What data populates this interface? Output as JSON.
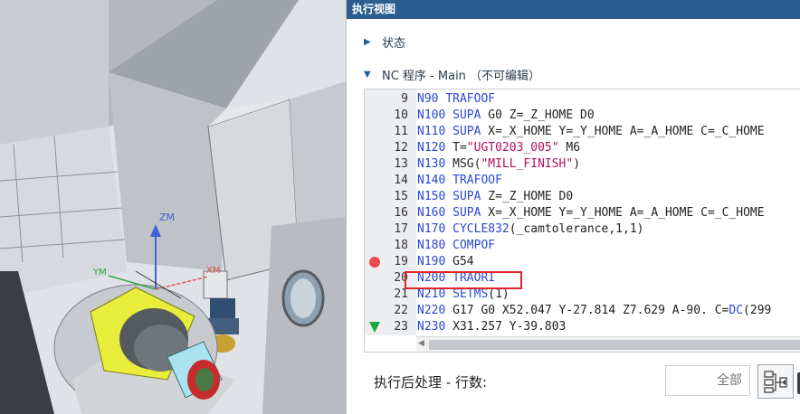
{
  "panel": {
    "title": "执行视图",
    "status_label": "状态",
    "nc_label": "NC 程序 - Main （不可编辑）"
  },
  "viewport": {
    "axis_zm": "ZM",
    "axis_xm": "XM",
    "axis_ym": "YM"
  },
  "code_lines": [
    {
      "num": "9",
      "parts": [
        [
          "N90 ",
          "kw"
        ],
        [
          "TRAFOOF",
          "kw"
        ]
      ]
    },
    {
      "num": "10",
      "parts": [
        [
          "N100 ",
          "kw"
        ],
        [
          "SUPA",
          "kw"
        ],
        [
          " G0 Z=",
          ""
        ],
        [
          "_Z_HOME",
          ""
        ],
        [
          " D0",
          ""
        ]
      ]
    },
    {
      "num": "11",
      "parts": [
        [
          "N110 ",
          "kw"
        ],
        [
          "SUPA",
          "kw"
        ],
        [
          " X=",
          ""
        ],
        [
          "_X_HOME",
          ""
        ],
        [
          " Y=",
          ""
        ],
        [
          "_Y_HOME",
          ""
        ],
        [
          " A=",
          ""
        ],
        [
          "_A_HOME",
          ""
        ],
        [
          " C=",
          ""
        ],
        [
          "_C_HOME",
          ""
        ]
      ]
    },
    {
      "num": "12",
      "parts": [
        [
          "N120 ",
          "kw"
        ],
        [
          "T=",
          ""
        ],
        [
          "\"UGT0203_005\"",
          "str"
        ],
        [
          " M6",
          ""
        ]
      ]
    },
    {
      "num": "13",
      "parts": [
        [
          "N130 ",
          "kw"
        ],
        [
          "MSG(",
          ""
        ],
        [
          "\"MILL_FINISH\"",
          "str"
        ],
        [
          ")",
          ""
        ]
      ]
    },
    {
      "num": "14",
      "parts": [
        [
          "N140 ",
          "kw"
        ],
        [
          "TRAFOOF",
          "kw"
        ]
      ]
    },
    {
      "num": "15",
      "parts": [
        [
          "N150 ",
          "kw"
        ],
        [
          "SUPA",
          "kw"
        ],
        [
          " Z=",
          ""
        ],
        [
          "_Z_HOME",
          ""
        ],
        [
          " D0",
          ""
        ]
      ]
    },
    {
      "num": "16",
      "parts": [
        [
          "N160 ",
          "kw"
        ],
        [
          "SUPA",
          "kw"
        ],
        [
          " X=",
          ""
        ],
        [
          "_X_HOME",
          ""
        ],
        [
          " Y=",
          ""
        ],
        [
          "_Y_HOME",
          ""
        ],
        [
          " A=",
          ""
        ],
        [
          "_A_HOME",
          ""
        ],
        [
          " C=",
          ""
        ],
        [
          "_C_HOME",
          ""
        ]
      ]
    },
    {
      "num": "17",
      "parts": [
        [
          "N170 ",
          "kw"
        ],
        [
          "CYCLE832",
          "kw"
        ],
        [
          "(_camtolerance,1,1)",
          ""
        ]
      ]
    },
    {
      "num": "18",
      "parts": [
        [
          "N180 ",
          "kw"
        ],
        [
          "COMPOF",
          "kw"
        ]
      ]
    },
    {
      "num": "19",
      "parts": [
        [
          "N190 ",
          "kw"
        ],
        [
          "G54",
          ""
        ]
      ],
      "breakpoint": true
    },
    {
      "num": "20",
      "parts": [
        [
          "N200 ",
          "kw"
        ],
        [
          "TRAORI",
          "kw"
        ]
      ]
    },
    {
      "num": "21",
      "parts": [
        [
          "N210 ",
          "kw"
        ],
        [
          "SETMS",
          "kw"
        ],
        [
          "(1)",
          ""
        ]
      ]
    },
    {
      "num": "22",
      "parts": [
        [
          "N220 ",
          "kw"
        ],
        [
          "G17 G0 X52.047 Y-27.814 Z7.629 A-90. C=",
          ""
        ],
        [
          "DC",
          "kw"
        ],
        [
          "(299",
          ""
        ]
      ]
    },
    {
      "num": "23",
      "parts": [
        [
          "N230 ",
          "kw"
        ],
        [
          "X31.257 Y-39.803",
          ""
        ]
      ],
      "current": true
    }
  ],
  "post": {
    "label": "执行后处理 - 行数:",
    "placeholder": "全部"
  },
  "colors": {
    "header_bg": "#2a5f8f",
    "keyword": "#2b46d8",
    "string": "#b0105a",
    "breakpoint": "#ee4a4a",
    "current_line": "#1fa83a",
    "highlight": "#e0252a"
  },
  "icons": {
    "status_expand": "triangle-right-icon",
    "nc_expand": "triangle-down-icon",
    "exec_button": "run-postprocess-icon"
  }
}
